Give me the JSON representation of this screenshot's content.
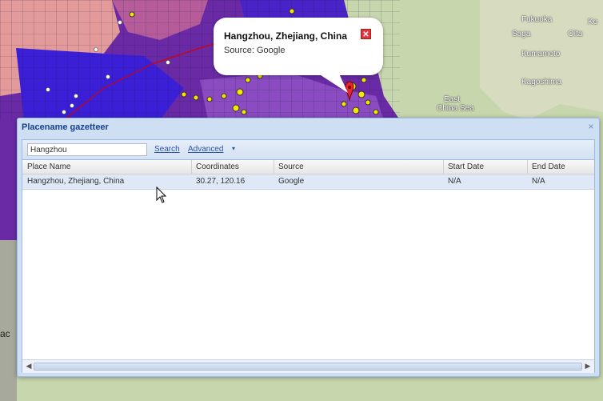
{
  "map": {
    "labels": {
      "fukuoka": "Fukuoka",
      "ko": "Ko",
      "saga": "Saga",
      "oita": "Oita",
      "kumamoto": "Kumamoto",
      "kagoshima": "Kagoshima",
      "east_china_sea_1": "East",
      "east_china_sea_2": "China Sea",
      "edge_ac": "ac"
    }
  },
  "bubble": {
    "title": "Hangzhou, Zhejiang, China",
    "source": "Source: Google",
    "close_label": "✕"
  },
  "window": {
    "title": "Placename gazetteer",
    "close_label": "×",
    "search": {
      "value": "Hangzhou",
      "search_label": "Search",
      "advanced_label": "Advanced",
      "advanced_caret": "▾"
    },
    "columns": [
      "Place Name",
      "Coordinates",
      "Source",
      "Start Date",
      "End Date"
    ],
    "rows": [
      {
        "place": "Hangzhou, Zhejiang, China",
        "coords": "30.27, 120.16",
        "source": "Google",
        "start": "N/A",
        "end": "N/A"
      }
    ],
    "scroll_left": "◀",
    "scroll_right": "▶"
  },
  "colors": {
    "choropleth_high": "#3b1fd6",
    "choropleth_mid": "#7a3aa8",
    "choropleth_low": "#e79a9a",
    "sea": "#c8d6ad",
    "marker": "#e32636"
  }
}
